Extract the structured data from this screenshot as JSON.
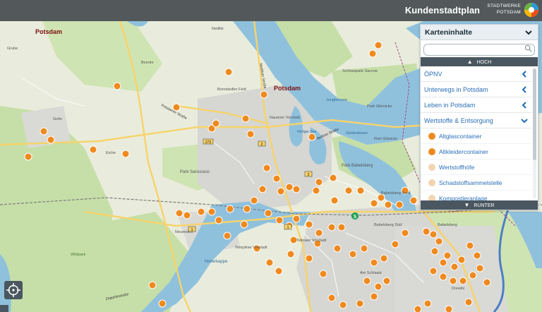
{
  "header": {
    "title": "Kundenstadtplan",
    "brand_line1": "STADTWERKE",
    "brand_line2": "POTSDAM"
  },
  "panel": {
    "title": "Karteninhalte",
    "search_placeholder": "",
    "scroll_up_label": "HOCH",
    "scroll_down_label": "RUNTER",
    "categories": [
      {
        "label": "ÖPNV",
        "expanded": false
      },
      {
        "label": "Unterwegs in Potsdam",
        "expanded": false
      },
      {
        "label": "Leben in Potsdam",
        "expanded": false
      },
      {
        "label": "Wertstoffe & Entsorgung",
        "expanded": true
      }
    ],
    "subitems": [
      {
        "label": "Altglascontainer",
        "active": true
      },
      {
        "label": "Altkleidercontainer",
        "active": true
      },
      {
        "label": "Wertstoffhöfe",
        "active": false
      },
      {
        "label": "Schadstoffsammelstelle",
        "active": false
      },
      {
        "label": "Kompostieranlage",
        "active": false
      }
    ]
  },
  "map": {
    "place_labels": [
      "Potsdam",
      "Potsdam",
      "Park Sanssouci",
      "Park Babelsberg",
      "Babelsberg Nord",
      "Babelsberg Süd",
      "Teltower Vorstadt",
      "Templiner Vorstadt",
      "Hinterkappe",
      "Wildpark",
      "Nauener Vorstadt",
      "Jungfernsee",
      "Schlosspark Sacrow",
      "Park Glienicke",
      "Griebnitzsee",
      "Am Schlaatz",
      "Bornstedter Feld",
      "Nedlitz",
      "Golm",
      "Grube",
      "Eiche",
      "Klein Glienicke",
      "Neuendorf",
      "Heiliger See",
      "Bornim",
      "Drewitz",
      "Babelsberg"
    ],
    "road_labels": [
      "Nedlitzer Straße",
      "Potsdamer Straße",
      "Berliner Straße",
      "Zeppelinstraße"
    ],
    "road_numbers": [
      "2",
      "1",
      "273",
      "2",
      "1"
    ],
    "colors": {
      "land": "#e9ecdc",
      "forest": "#c6dfa8",
      "water": "#8fc1dd",
      "urban": "#d6d6d3",
      "major_road": "#f7d36a",
      "poi_marker": "#ee8a1f",
      "header_bg": "#3e4448",
      "panel_link": "#2a6fb8"
    }
  },
  "controls": {
    "locate_icon": "crosshair-locate-icon"
  }
}
